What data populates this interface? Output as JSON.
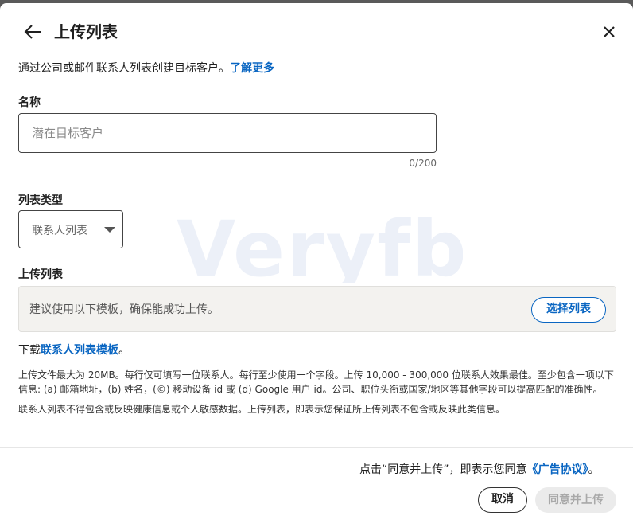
{
  "header": {
    "title": "上传列表"
  },
  "intro": {
    "text": "通过公司或邮件联系人列表创建目标客户。",
    "link": "了解更多"
  },
  "name_field": {
    "label": "名称",
    "placeholder": "潜在目标客户",
    "value": "",
    "counter": "0/200"
  },
  "list_type": {
    "label": "列表类型",
    "selected": "联系人列表"
  },
  "upload": {
    "label": "上传列表",
    "hint": "建议使用以下模板，确保能成功上传。",
    "button": "选择列表"
  },
  "download": {
    "prefix": "下载",
    "link": "联系人列表模板",
    "suffix": "。"
  },
  "info": {
    "line1": "上传文件最大为 20MB。每行仅可填写一位联系人。每行至少使用一个字段。上传 10,000 - 300,000 位联系人效果最佳。至少包含一项以下信息: (a) 邮箱地址，(b) 姓名，(©) 移动设备 id 或 (d) Google 用户 id。公司、职位头衔或国家/地区等其他字段可以提高匹配的准确性。",
    "line2": "联系人列表不得包含或反映健康信息或个人敏感数据。上传列表，即表示您保证所上传列表不包含或反映此类信息。"
  },
  "footer": {
    "consent_prefix": "点击“同意并上传”，即表示您同意",
    "consent_link": "《广告协议》",
    "consent_suffix": "。",
    "cancel": "取消",
    "submit": "同意并上传"
  },
  "watermark": "Veryfb",
  "colors": {
    "accent": "#0a66c2",
    "disabled_bg": "#ebebeb",
    "disabled_text": "#a9a9a9",
    "upload_bg": "#f3f2ef"
  },
  "icons": {
    "back": "arrow-left-icon",
    "close": "close-icon",
    "caret": "caret-down-icon"
  }
}
